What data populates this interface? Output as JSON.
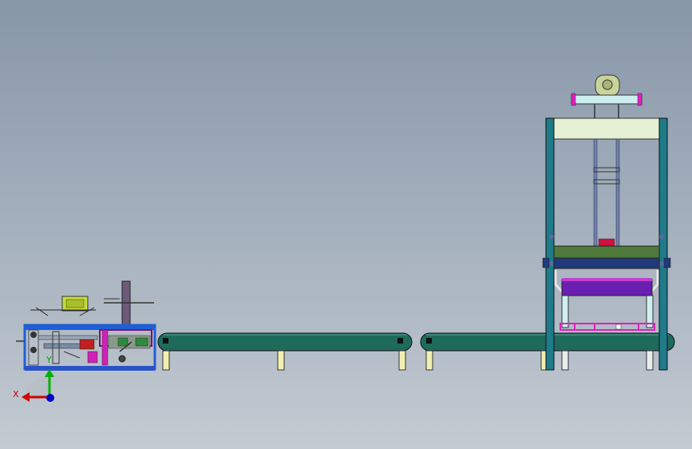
{
  "app": {
    "title": ""
  },
  "viewport": {
    "background_top": "#8796a8",
    "background_bottom": "#c3cad2"
  },
  "model": {
    "components": [
      "case-erector-machine",
      "belt-conveyor-1",
      "belt-conveyor-2",
      "box-sealing-press-frame"
    ],
    "colors": {
      "conveyor_belt": "#1e6b5c",
      "frame_blue": "#1f5fd6",
      "frame_teal": "#1f7a8a",
      "press_top": "#e6f0d4",
      "press_plate_green": "#4f7a3a",
      "press_plate_navy": "#203a7a",
      "press_box_purple": "#6a1fb0",
      "magenta": "#e020c0",
      "legs": "#f2f0b0",
      "cylinder_yellow": "#e9f2b0",
      "head_green": "#c8d49a"
    }
  },
  "triad": {
    "x_label": "X",
    "y_label": "Y",
    "x_color": "#d00000",
    "y_color": "#00b000",
    "z_color": "#0000c0"
  }
}
